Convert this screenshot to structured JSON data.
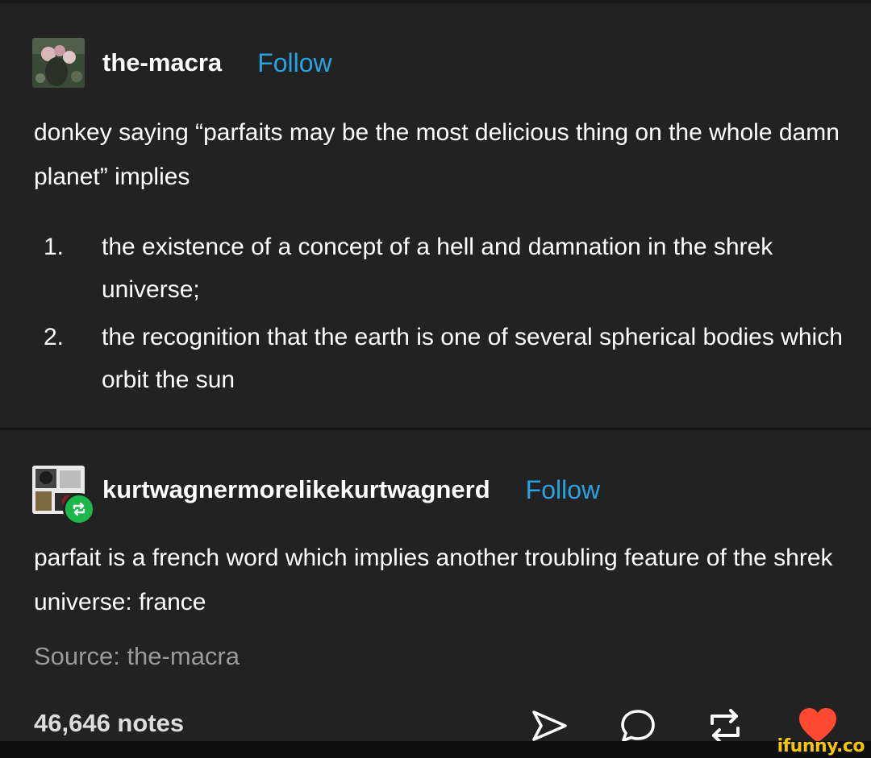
{
  "original_post": {
    "username": "the-macra",
    "follow_label": "Follow",
    "text": "donkey saying “parfaits may be the most delicious thing on the whole damn planet” implies",
    "list": [
      {
        "num": "1.",
        "text": "the existence of a concept of a hell and damnation in the shrek universe;"
      },
      {
        "num": "2.",
        "text": "the recognition that the earth is one of several spherical bodies which orbit the sun"
      }
    ]
  },
  "reblog": {
    "username": "kurtwagnermorelikekurtwagnerd",
    "follow_label": "Follow",
    "text": "parfait is a french word which implies another troubling feature of the shrek universe: france",
    "source": "Source: the-macra"
  },
  "footer": {
    "notes": "46,646 notes",
    "icons": [
      "share-icon",
      "reply-icon",
      "reblog-icon",
      "like-icon"
    ]
  },
  "watermark": "ifunny.co",
  "colors": {
    "background": "#222222",
    "follow": "#27a3e3",
    "reblog_badge": "#1cb84a",
    "like": "#ff4930",
    "source_text": "#9a9a9a"
  }
}
